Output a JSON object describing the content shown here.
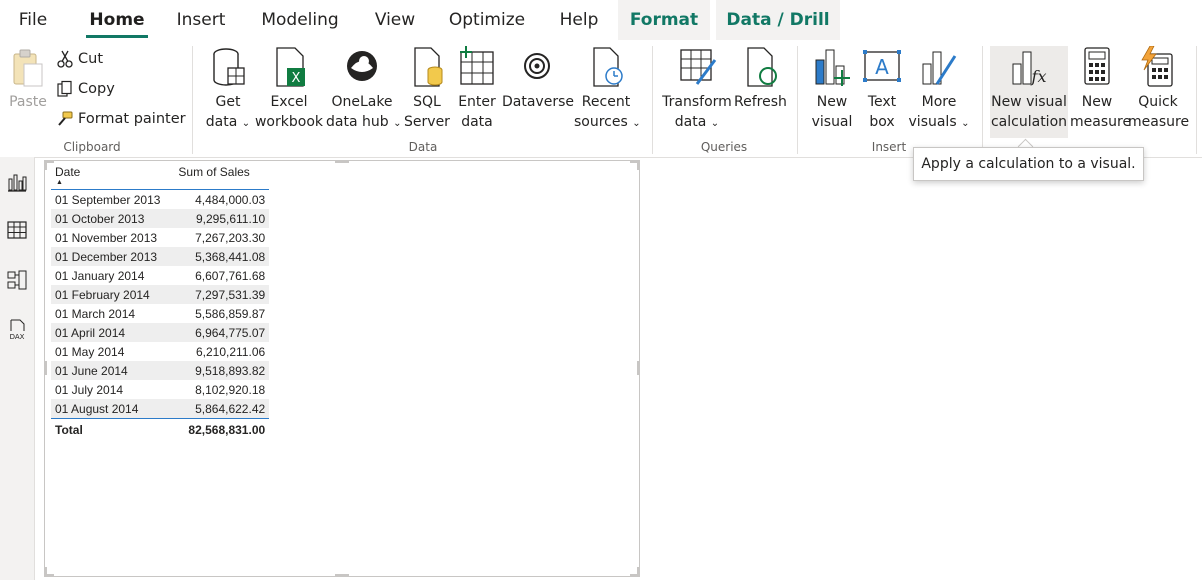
{
  "menu": {
    "tabs": [
      {
        "label": "File"
      },
      {
        "label": "Home"
      },
      {
        "label": "Insert"
      },
      {
        "label": "Modeling"
      },
      {
        "label": "View"
      },
      {
        "label": "Optimize"
      },
      {
        "label": "Help"
      },
      {
        "label": "Format"
      },
      {
        "label": "Data / Drill"
      }
    ],
    "active": "Home",
    "accent_color": "#117865"
  },
  "ribbon": {
    "clipboard": {
      "paste": "Paste",
      "cut": "Cut",
      "copy": "Copy",
      "format_painter": "Format painter",
      "group": "Clipboard"
    },
    "data": {
      "get_data": [
        "Get",
        "data"
      ],
      "excel": [
        "Excel",
        "workbook"
      ],
      "onelake": [
        "OneLake",
        "data hub"
      ],
      "sql": [
        "SQL",
        "Server"
      ],
      "enter": [
        "Enter",
        "data"
      ],
      "dataverse": [
        "Dataverse"
      ],
      "recent": [
        "Recent",
        "sources"
      ],
      "group": "Data"
    },
    "queries": {
      "transform": [
        "Transform",
        "data"
      ],
      "refresh": [
        "Refresh"
      ],
      "group": "Queries"
    },
    "insert": {
      "new_visual": [
        "New",
        "visual"
      ],
      "text_box": [
        "Text",
        "box"
      ],
      "more_visuals": [
        "More",
        "visuals"
      ],
      "group": "Insert"
    },
    "calculations": {
      "new_visual_calc": [
        "New visual",
        "calculation"
      ],
      "new_measure": [
        "New",
        "measure"
      ],
      "quick_measure": [
        "Quick",
        "measure"
      ]
    }
  },
  "tooltip": {
    "text": "Apply a calculation to a visual."
  },
  "rail": {
    "icons": [
      "report-view-icon",
      "table-view-icon",
      "model-view-icon",
      "dax-query-view-icon"
    ],
    "dax_label": "DAX"
  },
  "table": {
    "headers": [
      "Date",
      "Sum of Sales"
    ],
    "rows": [
      [
        "01 September 2013",
        "4,484,000.03"
      ],
      [
        "01 October 2013",
        "9,295,611.10"
      ],
      [
        "01 November 2013",
        "7,267,203.30"
      ],
      [
        "01 December 2013",
        "5,368,441.08"
      ],
      [
        "01 January 2014",
        "6,607,761.68"
      ],
      [
        "01 February 2014",
        "7,297,531.39"
      ],
      [
        "01 March 2014",
        "5,586,859.87"
      ],
      [
        "01 April 2014",
        "6,964,775.07"
      ],
      [
        "01 May 2014",
        "6,210,211.06"
      ],
      [
        "01 June 2014",
        "9,518,893.82"
      ],
      [
        "01 July 2014",
        "8,102,920.18"
      ],
      [
        "01 August 2014",
        "5,864,622.42"
      ]
    ],
    "total_label": "Total",
    "total_value": "82,568,831.00"
  }
}
